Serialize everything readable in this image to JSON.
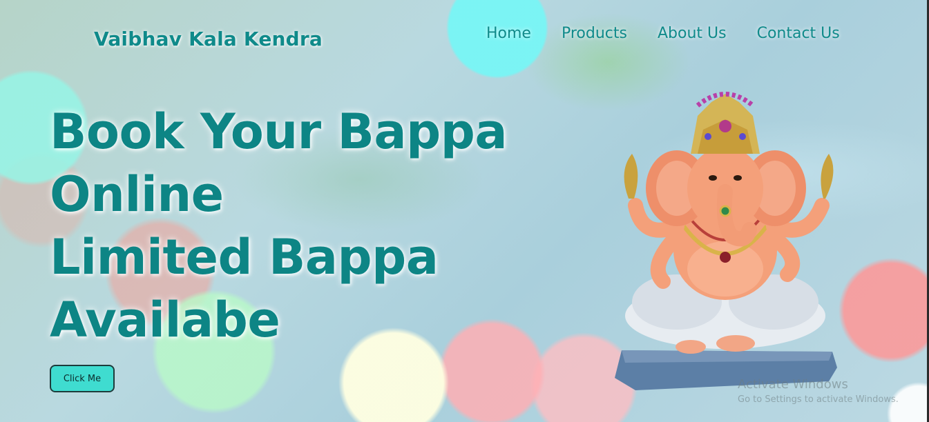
{
  "brand": {
    "name": "Vaibhav Kala Kendra"
  },
  "nav": {
    "items": [
      {
        "label": "Home"
      },
      {
        "label": "Products"
      },
      {
        "label": "About Us"
      },
      {
        "label": "Contact Us"
      }
    ]
  },
  "hero": {
    "lines": [
      "Book Your Bappa",
      "Online",
      "Limited Bappa",
      "Availabe"
    ],
    "button_label": "Click Me"
  },
  "watermark": {
    "title": "Activate Windows",
    "subtitle": "Go to Settings to activate Windows."
  },
  "colors": {
    "accent": "#0f8a8a",
    "button_bg": "#3fdcd0"
  }
}
